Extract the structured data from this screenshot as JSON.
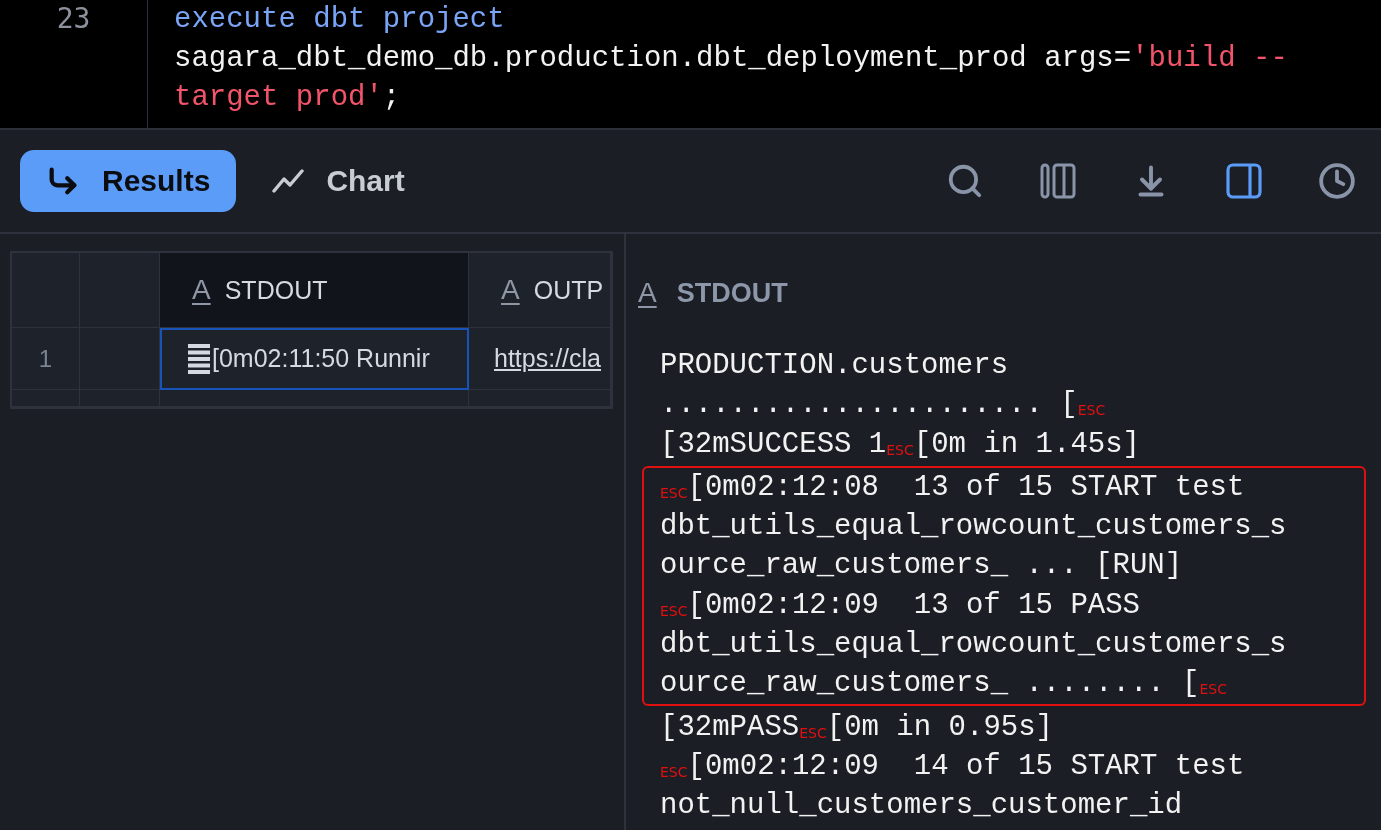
{
  "editor": {
    "line_number": "23",
    "lines": [
      [
        {
          "kind": "keyword",
          "text": "execute dbt project"
        }
      ],
      [
        {
          "kind": "plain",
          "text": "sagara_dbt_demo_db.production.dbt_deployment_prod args="
        },
        {
          "kind": "string",
          "text": "'build --"
        }
      ],
      [
        {
          "kind": "string",
          "text": "target prod'"
        },
        {
          "kind": "plain",
          "text": ";"
        }
      ]
    ]
  },
  "toolbar": {
    "tabs": [
      {
        "kind": "results",
        "label": "Results",
        "selected": true
      },
      {
        "kind": "chart",
        "label": "Chart",
        "selected": false
      }
    ],
    "actions": [
      {
        "kind": "search",
        "selected": false
      },
      {
        "kind": "columns",
        "selected": false
      },
      {
        "kind": "download",
        "selected": false
      },
      {
        "kind": "panel",
        "selected": true
      },
      {
        "kind": "history",
        "selected": false
      }
    ]
  },
  "grid": {
    "columns": [
      {
        "type_glyph": "A",
        "label": "STDOUT",
        "selected": true
      },
      {
        "type_glyph": "A",
        "label": "OUTP",
        "selected": false
      }
    ],
    "rows": [
      {
        "number": "1",
        "cells": [
          {
            "kind": "escaped",
            "text": "[0m02:11:50  Runnir",
            "selected": true
          },
          {
            "kind": "link",
            "text": "https://cla",
            "selected": false
          }
        ]
      }
    ]
  },
  "detail": {
    "type_glyph": "A",
    "title": "STDOUT",
    "blocks": [
      {
        "highlighted": false,
        "lines": [
          "PRODUCTION.customers",
          "...................... [$_{ESC}$",
          "[32mSUCCESS 1$_{ESC}$[0m in 1.45s]"
        ]
      },
      {
        "highlighted": true,
        "lines": [
          "$_{ESC}$[0m02:12:08  13 of 15 START test",
          "dbt_utils_equal_rowcount_customers_s",
          "ource_raw_customers_ ... [RUN]",
          "$_{ESC}$[0m02:12:09  13 of 15 PASS",
          "dbt_utils_equal_rowcount_customers_s",
          "ource_raw_customers_ ........ [$_{ESC}$"
        ]
      },
      {
        "highlighted": false,
        "lines": [
          "[32mPASS$_{ESC}$[0m in 0.95s]",
          "$_{ESC}$[0m02:12:09  14 of 15 START test",
          "not_null_customers_customer_id"
        ]
      }
    ]
  }
}
